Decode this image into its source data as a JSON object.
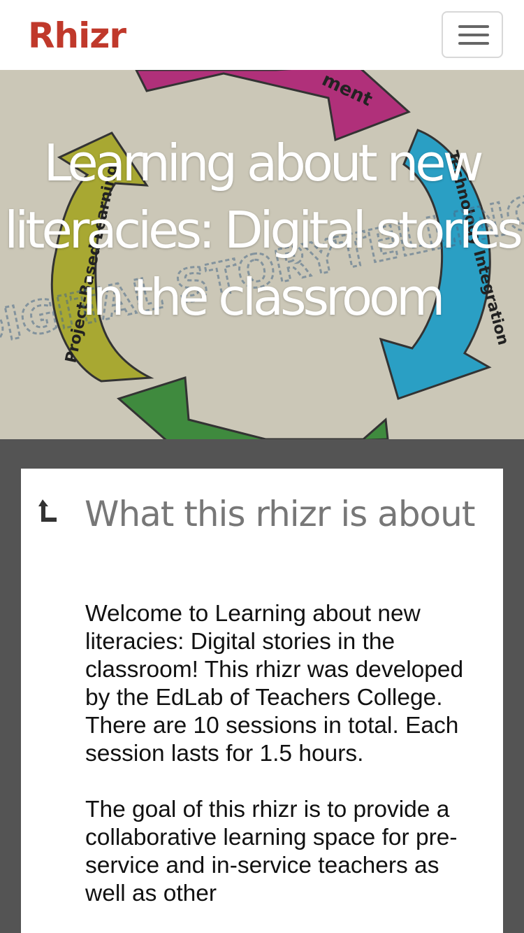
{
  "navbar": {
    "brand": "Rhizr",
    "menu_button": "toggle navigation"
  },
  "hero": {
    "title": "Learning about new literacies: Digital stories in the classroom",
    "image_text": {
      "center": "DIGITAL STORYTELLING",
      "arrow_top": "ment",
      "arrow_left": "Project-Based Learning",
      "arrow_right": "Technology Integration"
    }
  },
  "about": {
    "title": "What this rhizr is about",
    "paragraphs": [
      "Welcome to Learning about new literacies: Digital stories in the classroom! This rhizr was developed by the EdLab of Teachers College. There are 10 sessions in total. Each session lasts for 1.5 hours.",
      "The goal of this rhizr is to provide a collaborative learning space for pre-service and in-service teachers as well as other"
    ]
  },
  "colors": {
    "brand": "#c0392b",
    "page_background": "#545454",
    "hero_background": "#cbc7b7",
    "arrow_magenta": "#b0307a",
    "arrow_olive": "#a8a832",
    "arrow_blue": "#2a9fc4",
    "arrow_green": "#3f8a3e"
  }
}
